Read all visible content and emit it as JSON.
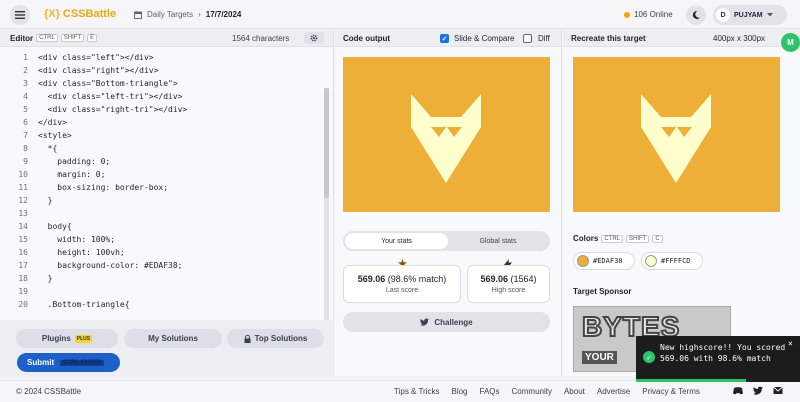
{
  "header": {
    "logo_mark": "{X}",
    "logo_text": "CSSBattle",
    "crumb_section": "Daily Targets",
    "crumb_sep": "›",
    "crumb_date": "17/7/2024",
    "online": "106 Online",
    "user_initial": "D",
    "username": "PUJYAM"
  },
  "editor": {
    "title": "Editor",
    "keys": [
      "CTRL",
      "SHIFT",
      "E"
    ],
    "char_count": "1564 characters",
    "lines": [
      {
        "n": "1",
        "t": "<div class=\"left\"></div>"
      },
      {
        "n": "2",
        "t": "<div class=\"right\"></div>"
      },
      {
        "n": "3",
        "t": "<div class=\"Bottom-triangle\">"
      },
      {
        "n": "4",
        "t": "  <div class=\"left-tri\"></div>"
      },
      {
        "n": "5",
        "t": "  <div class=\"right-tri\"></div>"
      },
      {
        "n": "6",
        "t": "</div>"
      },
      {
        "n": "7",
        "t": "<style>"
      },
      {
        "n": "8",
        "t": "  *{"
      },
      {
        "n": "9",
        "t": "    padding: 0;"
      },
      {
        "n": "10",
        "t": "    margin: 0;"
      },
      {
        "n": "11",
        "t": "    box-sizing: border-box;"
      },
      {
        "n": "12",
        "t": "  }"
      },
      {
        "n": "13",
        "t": ""
      },
      {
        "n": "14",
        "t": "  body{"
      },
      {
        "n": "15",
        "t": "    width: 100%;"
      },
      {
        "n": "16",
        "t": "    height: 100vh;"
      },
      {
        "n": "17",
        "t": "    background-color: #EDAF38;"
      },
      {
        "n": "18",
        "t": "  }"
      },
      {
        "n": "19",
        "t": ""
      },
      {
        "n": "20",
        "t": "  .Bottom-triangle{"
      }
    ],
    "plugins_label": "Plugins",
    "plus_badge": "PLUS",
    "my_solutions_label": "My Solutions",
    "top_solutions_label": "Top Solutions",
    "submit_label": "Submit",
    "submit_keys": "CTRL ENTER"
  },
  "output": {
    "title": "Code output",
    "slide_compare_label": "Slide & Compare",
    "slide_compare_checked": true,
    "diff_label": "Diff",
    "diff_checked": false,
    "tab_your_stats": "Your stats",
    "tab_global_stats": "Global stats",
    "score_value": "569.06",
    "score_match": "(98.6% match)",
    "score_label": "Last score",
    "high_score_value": "569.06",
    "high_score_chars": "(1564)",
    "high_score_label": "High score",
    "challenge_label": "Challenge"
  },
  "target": {
    "title": "Recreate this target",
    "size": "400px x 300px",
    "colors_label": "Colors",
    "color_keys": [
      "CTRL",
      "SHIFT",
      "C"
    ],
    "colors": [
      {
        "hex": "#EDAF38",
        "swatch": "#EDAF38"
      },
      {
        "hex": "#FFFFCD",
        "swatch": "#FFFFCD"
      }
    ],
    "sponsor_label": "Target Sponsor",
    "sponsor_name": "BYTES",
    "sponsor_sub": "YOUR"
  },
  "toast": {
    "message": "New highscore!! You scored 569.06 with 98.6% match",
    "close": "×"
  },
  "footer": {
    "copyright": "© 2024 CSSBattle",
    "links": [
      "Tips & Tricks",
      "Blog",
      "FAQs",
      "Community",
      "About",
      "Advertise",
      "Privacy & Terms"
    ]
  },
  "colors": {
    "accent": "#EDAF38",
    "cream": "#FFFFCD",
    "submit": "#1F5FC9",
    "success": "#2EC26A"
  }
}
